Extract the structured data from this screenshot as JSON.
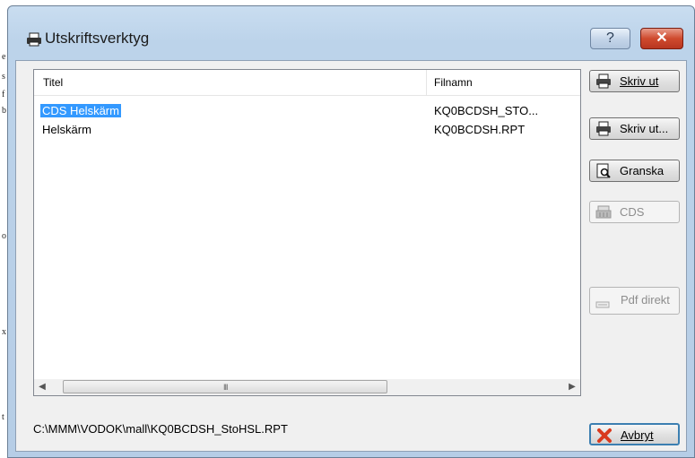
{
  "window": {
    "title": "Utskriftsverktyg",
    "help": "?",
    "close": "✕"
  },
  "listview": {
    "columns": {
      "title": "Titel",
      "filename": "Filnamn"
    },
    "rows": [
      {
        "title": "CDS Helskärm",
        "filename": "KQ0BCDSH_STO...",
        "selected": true
      },
      {
        "title": "Helskärm",
        "filename": "KQ0BCDSH.RPT",
        "selected": false
      }
    ],
    "scroll_grip": "III"
  },
  "status_path": "C:\\MMM\\VODOK\\mall\\KQ0BCDSH_StoHSL.RPT",
  "buttons": {
    "print": "Skriv ut",
    "print_dialog": "Skriv ut...",
    "preview": "Granska",
    "cds": "CDS",
    "pdf": "Pdf direkt",
    "cancel": "Avbryt"
  }
}
